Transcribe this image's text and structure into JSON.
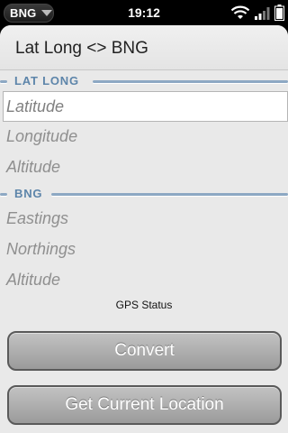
{
  "statusbar": {
    "app_name": "BNG",
    "time": "19:12"
  },
  "header": {
    "title": "Lat Long <> BNG"
  },
  "lat_long_section": {
    "label": "LAT LONG",
    "fields": {
      "latitude": "Latitude",
      "longitude": "Longitude",
      "altitude": "Altitude"
    }
  },
  "bng_section": {
    "label": "BNG",
    "fields": {
      "eastings": "Eastings",
      "northings": "Northings",
      "altitude": "Altitude"
    }
  },
  "gps_status": "GPS Status",
  "buttons": {
    "convert": "Convert",
    "get_location": "Get Current Location"
  },
  "colors": {
    "section_label": "#5d85aa",
    "section_line": "#8da8c3",
    "card_background": "#e9e9e9"
  }
}
